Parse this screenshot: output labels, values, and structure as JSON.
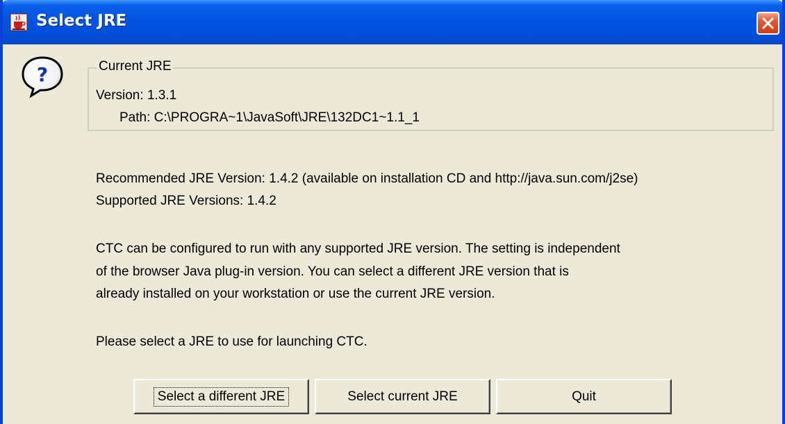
{
  "window": {
    "title": "Select JRE",
    "title_bar_color": "#0054e3",
    "background_color": "#ece9d8"
  },
  "icons": {
    "app_icon": "java-cup-icon",
    "close_icon": "close-icon",
    "message_icon": "question-icon"
  },
  "current_jre": {
    "group_title": "Current JRE",
    "version_label": "Version:",
    "version_value": "1.3.1",
    "path_label": "Path:",
    "path_value": "C:\\PROGRA~1\\JavaSoft\\JRE\\132DC1~1.1_1"
  },
  "info": {
    "recommended_label": "Recommended JRE Version:",
    "recommended_value": "1.4.2 (available on installation CD and http://java.sun.com/j2se)",
    "supported_label": "Supported JRE Versions:",
    "supported_value": "1.4.2",
    "paragraph_lines": [
      "CTC can be configured to run with any supported JRE version.  The setting is independent",
      "of the browser Java plug-in version.  You can select a different JRE version that is",
      "already installed on your workstation or use the current JRE version."
    ],
    "prompt": "Please select a JRE to use for launching CTC."
  },
  "buttons": {
    "select_different": "Select a different JRE",
    "select_current": "Select current JRE",
    "quit": "Quit"
  }
}
